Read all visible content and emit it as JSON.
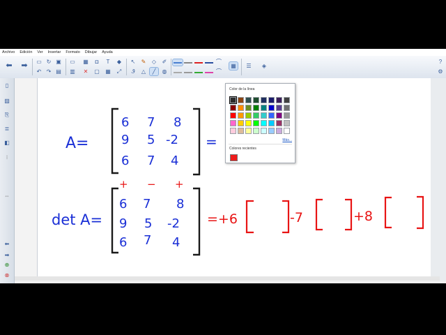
{
  "menu": [
    "Archivo",
    "Edición",
    "Ver",
    "Insertar",
    "Formato",
    "Dibujar",
    "Ayuda"
  ],
  "popup": {
    "title": "Color de la línea",
    "more": "Más...",
    "recent_title": "Colores recientes",
    "swatches": [
      "#2b2b2b",
      "#8b4513",
      "#2f4f4f",
      "#1f4e2f",
      "#1f2f5f",
      "#1c1c6c",
      "#3b1f5a",
      "#404040",
      "#8b0000",
      "#ff8c00",
      "#6b8e23",
      "#008000",
      "#008080",
      "#0000cd",
      "#5a3f8f",
      "#707070",
      "#ff0000",
      "#ff9900",
      "#99cc00",
      "#33cc66",
      "#33cccc",
      "#3366ff",
      "#800080",
      "#999999",
      "#ff66cc",
      "#ffcc00",
      "#ffff00",
      "#00ff00",
      "#00ffff",
      "#00ccff",
      "#993366",
      "#c0c0c0",
      "#ffccdd",
      "#ddbb99",
      "#ffff99",
      "#ccffcc",
      "#ccffff",
      "#99ccff",
      "#ccaadd",
      "#ffffff"
    ],
    "selected_index": 0,
    "recent": [
      "#ee1c1c"
    ]
  },
  "ink": {
    "matrix_label": "A=",
    "rows": [
      [
        "6",
        "7",
        "8"
      ],
      [
        "9",
        "5",
        "-2"
      ],
      [
        "6",
        "7",
        "4"
      ]
    ],
    "eq1": "=",
    "signs": [
      "+",
      "−",
      "+"
    ],
    "det_label": "det A=",
    "drows": [
      [
        "6",
        "7",
        "8"
      ],
      [
        "9",
        "5",
        "-2"
      ],
      [
        "6",
        "7",
        "4"
      ]
    ],
    "expansion": [
      "=+6",
      "-7",
      "+8"
    ],
    "pen_blue": "#1a2fd6",
    "pen_red": "#e81414"
  }
}
